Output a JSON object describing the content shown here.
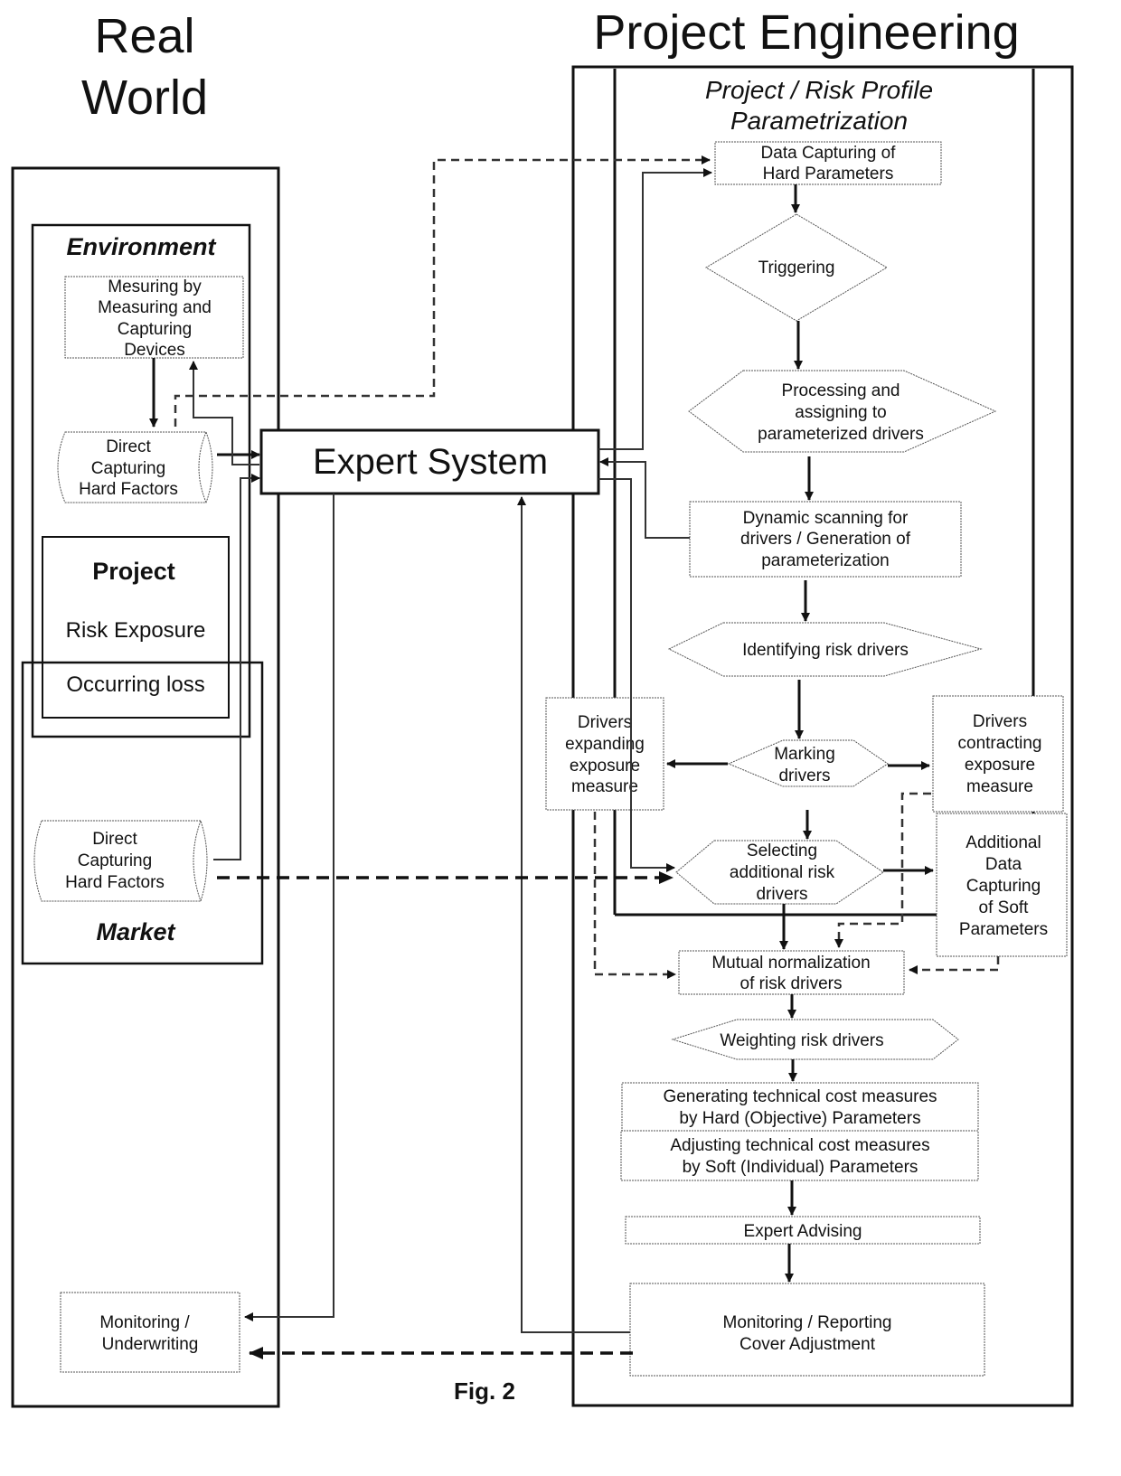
{
  "titles": {
    "real_world_line1": "Real",
    "real_world_line2": "World",
    "project_engineering": "Project Engineering",
    "parametrization_line1": "Project / Risk Profile",
    "parametrization_line2": "Parametrization",
    "figure_caption": "Fig. 2"
  },
  "real_world": {
    "environment_label": "Environment",
    "measuring_box": [
      "Mesuring by",
      "Measuring and",
      "Capturing",
      "Devices"
    ],
    "direct_capturing_env": [
      "Direct",
      "Capturing",
      "Hard Factors"
    ],
    "project_label": "Project",
    "risk_exposure_label": "Risk Exposure",
    "occurring_loss_label": "Occurring loss",
    "direct_capturing_market": [
      "Direct",
      "Capturing",
      "Hard Factors"
    ],
    "market_label": "Market",
    "monitoring_underwriting": [
      "Monitoring /",
      "Underwriting"
    ]
  },
  "expert_system": {
    "label": "Expert System"
  },
  "flow": {
    "data_capturing_hard": [
      "Data Capturing of",
      "Hard Parameters"
    ],
    "triggering": "Triggering",
    "processing": [
      "Processing and",
      "assigning to",
      "parameterized drivers"
    ],
    "dynamic_scanning": [
      "Dynamic scanning for",
      "drivers / Generation of",
      "parameterization"
    ],
    "identifying": "Identifying risk drivers",
    "marking": [
      "Marking",
      "drivers"
    ],
    "drivers_expanding": [
      "Drivers",
      "expanding",
      "exposure",
      "measure"
    ],
    "drivers_contracting": [
      "Drivers",
      "contracting",
      "exposure",
      "measure"
    ],
    "selecting": [
      "Selecting",
      "additional  risk",
      "drivers"
    ],
    "additional_soft": [
      "Additional",
      "Data",
      "Capturing",
      "of Soft",
      "Parameters"
    ],
    "mutual_normalization": [
      "Mutual normalization",
      "of risk drivers"
    ],
    "weighting": "Weighting risk drivers",
    "generating": [
      "Generating technical cost measures",
      "by Hard (Objective) Parameters"
    ],
    "adjusting": [
      "Adjusting technical cost measures",
      "by Soft (Individual) Parameters"
    ],
    "expert_advising": "Expert Advising",
    "monitoring_reporting": [
      "Monitoring / Reporting",
      "Cover Adjustment"
    ]
  }
}
